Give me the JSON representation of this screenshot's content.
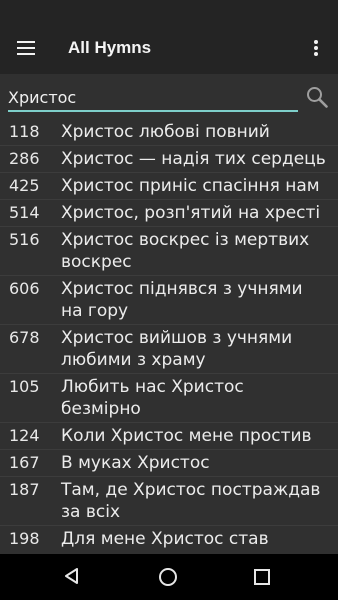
{
  "app_bar": {
    "title": "All Hymns",
    "menu_icon": "hamburger-menu-icon",
    "overflow_icon": "more-vert-icon"
  },
  "search": {
    "value": "Христос",
    "icon": "search-icon",
    "accent_color": "#7ecfca"
  },
  "hymns": [
    {
      "number": "118",
      "title": "Христос любові повний"
    },
    {
      "number": "286",
      "title": "Христос — надія тих сердець"
    },
    {
      "number": "425",
      "title": "Христос приніс спасіння нам"
    },
    {
      "number": "514",
      "title": "Христос, розп'ятий на хресті"
    },
    {
      "number": "516",
      "title": "Христос воскрес із мертвих воскрес"
    },
    {
      "number": "606",
      "title": "Христос піднявся з учнями на гору"
    },
    {
      "number": "678",
      "title": "Христос вийшов з учнями любими з храму"
    },
    {
      "number": "105",
      "title": "Любить нас Христос безмірно"
    },
    {
      "number": "124",
      "title": "Коли Христос мене простив"
    },
    {
      "number": "167",
      "title": "В муках Христос"
    },
    {
      "number": "187",
      "title": "Там, де Христос постраждав за всіх"
    },
    {
      "number": "198",
      "title": "Для мене Христос став дорожчим за все"
    }
  ],
  "system_nav": {
    "back_icon": "back-triangle-icon",
    "home_icon": "home-circle-icon",
    "recents_icon": "recents-square-icon"
  }
}
